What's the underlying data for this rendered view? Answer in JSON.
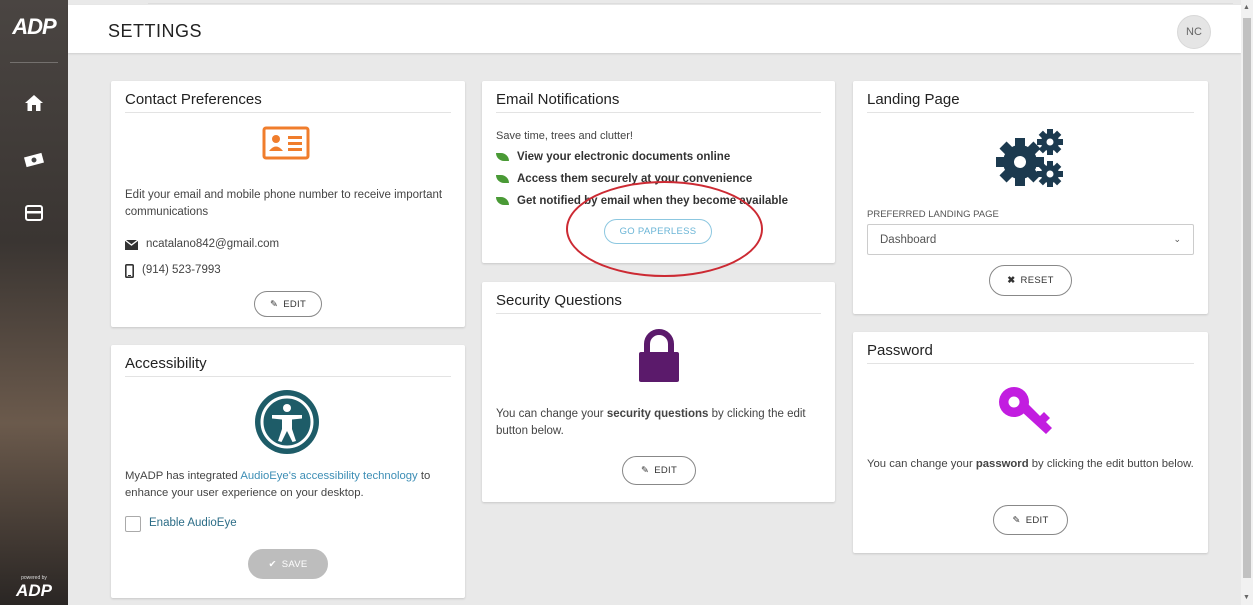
{
  "sidebar": {
    "logo": "ADP",
    "powered_by": "powered by",
    "bottom_logo": "ADP"
  },
  "header": {
    "title": "SETTINGS",
    "avatar_initials": "NC"
  },
  "contact": {
    "title": "Contact Preferences",
    "description": "Edit your email and mobile phone number to receive important communications",
    "email": "ncatalano842@gmail.com",
    "phone": "(914) 523-7993",
    "edit_label": "EDIT"
  },
  "accessibility": {
    "title": "Accessibility",
    "text_before": "MyADP has integrated ",
    "link_text": "AudioEye's accessibility technology",
    "text_after": " to enhance your user experience on your desktop.",
    "checkbox_label": "Enable AudioEye",
    "save_label": "SAVE"
  },
  "email_notifications": {
    "title": "Email Notifications",
    "intro": "Save time, trees and clutter!",
    "bullets": [
      "View your electronic documents online",
      "Access them securely at your convenience",
      "Get notified by email when they become available"
    ],
    "button_label": "GO PAPERLESS"
  },
  "security": {
    "title": "Security Questions",
    "text_before": "You can change your ",
    "text_bold": "security questions",
    "text_after": " by clicking the edit button below.",
    "edit_label": "EDIT"
  },
  "landing": {
    "title": "Landing Page",
    "field_label": "PREFERRED LANDING PAGE",
    "selected": "Dashboard",
    "reset_label": "RESET"
  },
  "password": {
    "title": "Password",
    "text_before": "You can change your ",
    "text_bold": "password",
    "text_after": " by clicking the edit button below.",
    "edit_label": "EDIT"
  },
  "colors": {
    "accent_orange": "#f07d2c",
    "security_purple": "#5b1a6b",
    "password_magenta": "#c21de0",
    "gear_navy": "#1c3a4f",
    "paperless_blue": "#6bb5d6",
    "highlight_red": "#cc2a33"
  }
}
